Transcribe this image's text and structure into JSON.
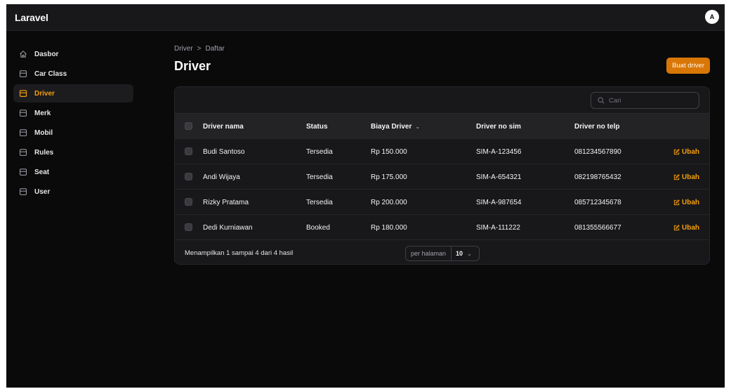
{
  "app": {
    "brand": "Laravel",
    "avatar_initial": "A"
  },
  "sidebar": {
    "items": [
      {
        "label": "Dasbor",
        "icon": "home-icon",
        "active": false
      },
      {
        "label": "Car Class",
        "icon": "box-icon",
        "active": false
      },
      {
        "label": "Driver",
        "icon": "box-icon",
        "active": true
      },
      {
        "label": "Merk",
        "icon": "box-icon",
        "active": false
      },
      {
        "label": "Mobil",
        "icon": "box-icon",
        "active": false
      },
      {
        "label": "Rules",
        "icon": "box-icon",
        "active": false
      },
      {
        "label": "Seat",
        "icon": "box-icon",
        "active": false
      },
      {
        "label": "User",
        "icon": "box-icon",
        "active": false
      }
    ]
  },
  "breadcrumb": {
    "items": [
      "Driver",
      "Daftar"
    ],
    "separator": ">"
  },
  "page": {
    "title": "Driver",
    "create_button": "Buat driver"
  },
  "search": {
    "placeholder": "Cari"
  },
  "table": {
    "columns": [
      "Driver nama",
      "Status",
      "Biaya Driver",
      "Driver no sim",
      "Driver no telp"
    ],
    "rows": [
      {
        "nama": "Budi Santoso",
        "status": "Tersedia",
        "biaya": "Rp 150.000",
        "sim": "SIM-A-123456",
        "telp": "081234567890",
        "action": "Ubah"
      },
      {
        "nama": "Andi Wijaya",
        "status": "Tersedia",
        "biaya": "Rp 175.000",
        "sim": "SIM-A-654321",
        "telp": "082198765432",
        "action": "Ubah"
      },
      {
        "nama": "Rizky Pratama",
        "status": "Tersedia",
        "biaya": "Rp 200.000",
        "sim": "SIM-A-987654",
        "telp": "085712345678",
        "action": "Ubah"
      },
      {
        "nama": "Dedi Kurniawan",
        "status": "Booked",
        "biaya": "Rp 180.000",
        "sim": "SIM-A-111222",
        "telp": "081355566677",
        "action": "Ubah"
      }
    ]
  },
  "pagination": {
    "summary": "Menampilkan 1 sampai 4 dari 4 hasil",
    "per_page_label": "per halaman",
    "per_page_value": "10"
  },
  "colors": {
    "accent": "#f59e0b",
    "button": "#d97706",
    "background": "#0a0a0b",
    "card": "#18181b"
  }
}
